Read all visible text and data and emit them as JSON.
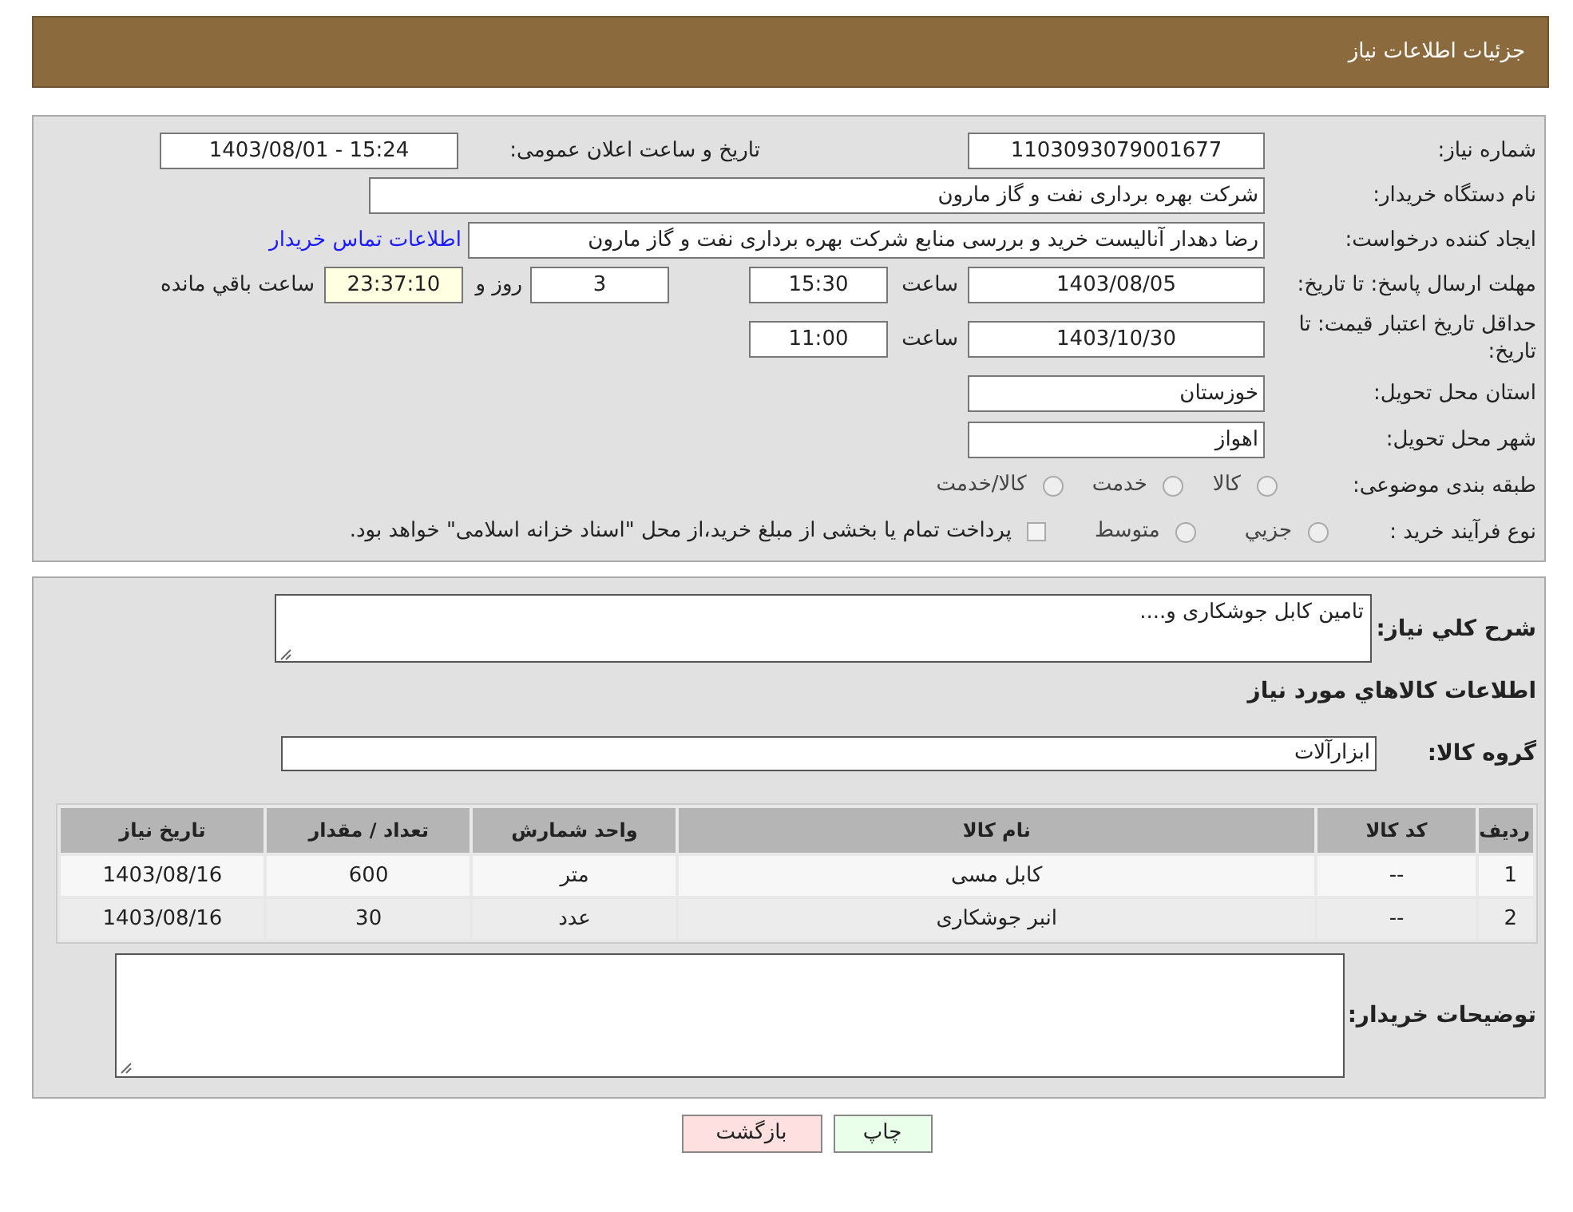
{
  "header": {
    "title": "جزئیات اطلاعات نیاز"
  },
  "details": {
    "need_number": {
      "label": "شماره نیاز:",
      "value": "1103093079001677"
    },
    "announce": {
      "label": "تاریخ و ساعت اعلان عمومی:",
      "value": "1403/08/01 - 15:24"
    },
    "buyer_org": {
      "label": "نام دستگاه خریدار:",
      "value": "شرکت بهره برداری نفت و گاز مارون"
    },
    "requester": {
      "label": "ایجاد کننده درخواست:",
      "value": "رضا دهدار آنالیست خرید و بررسی منابع شرکت بهره برداری نفت و گاز مارون",
      "link": "اطلاعات تماس خریدار"
    },
    "reply_deadline": {
      "label": "مهلت ارسال پاسخ: تا تاریخ:",
      "date": "1403/08/05",
      "time_label": "ساعت",
      "time": "15:30",
      "days": "3",
      "days_label": "روز و",
      "remaining": "23:37:10",
      "remaining_label": "ساعت باقي مانده"
    },
    "price_validity": {
      "label": "حداقل تاریخ اعتبار قیمت: تا تاریخ:",
      "date": "1403/10/30",
      "time_label": "ساعت",
      "time": "11:00"
    },
    "province": {
      "label": "استان محل تحویل:",
      "value": "خوزستان"
    },
    "city": {
      "label": "شهر محل تحویل:",
      "value": "اهواز"
    },
    "category": {
      "label": "طبقه بندی موضوعی:",
      "options": [
        {
          "label": "کالا",
          "selected": false
        },
        {
          "label": "خدمت",
          "selected": false
        },
        {
          "label": "کالا/خدمت",
          "selected": false
        }
      ]
    },
    "process": {
      "label": "نوع فرآیند خرید :",
      "options": [
        {
          "label": "جزيي",
          "selected": false
        },
        {
          "label": "متوسط",
          "selected": false
        }
      ],
      "payment_note": {
        "text": "پرداخت تمام یا بخشی از مبلغ خرید،از محل \"اسناد خزانه اسلامی\" خواهد بود.",
        "checked": false
      }
    }
  },
  "summary": {
    "label": "شرح کلي نياز:",
    "value": "تامین کابل جوشکاری و....",
    "items_heading": "اطلاعات کالاهاي مورد نياز",
    "group": {
      "label": "گروه کالا:",
      "value": "ابزارآلات"
    },
    "table": {
      "columns": [
        "ردیف",
        "کد کالا",
        "نام کالا",
        "واحد شمارش",
        "تعداد / مقدار",
        "تاریخ نیاز"
      ],
      "rows": [
        [
          "1",
          "--",
          "کابل مسی",
          "متر",
          "600",
          "1403/08/16"
        ],
        [
          "2",
          "--",
          "انبر جوشکاری",
          "عدد",
          "30",
          "1403/08/16"
        ]
      ]
    },
    "buyer_notes": {
      "label": "توضیحات خریدار:"
    }
  },
  "buttons": [
    {
      "label": "چاپ",
      "kind": "print"
    },
    {
      "label": "بازگشت",
      "kind": "back"
    }
  ]
}
